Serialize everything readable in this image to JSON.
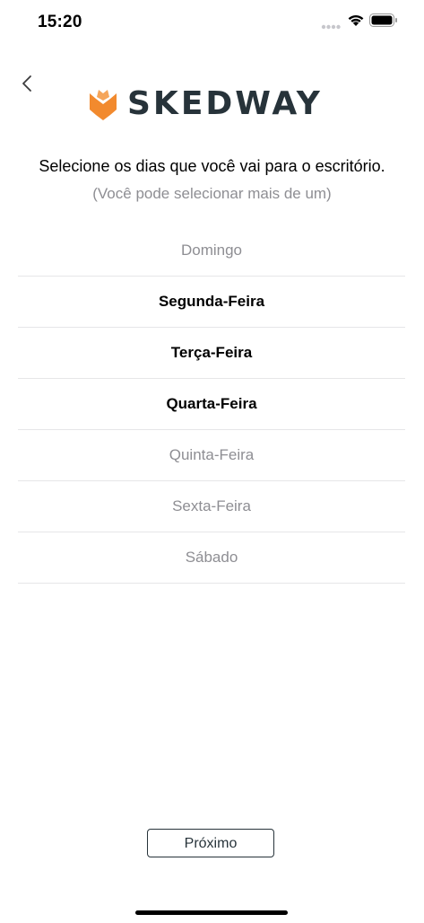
{
  "status_bar": {
    "time": "15:20"
  },
  "icons": {
    "signal": "signal-dots-icon",
    "wifi": "wifi-icon",
    "battery": "battery-icon",
    "back": "chevron-left-icon",
    "logo": "fox-logo-icon"
  },
  "brand": {
    "name": "SKEDWAY",
    "mark_color": "#f28a2e",
    "text_color": "#27333a"
  },
  "header": {
    "title": "Selecione os dias que você vai para o escritório.",
    "subtitle": "(Você pode selecionar mais de um)"
  },
  "days": [
    {
      "label": "Domingo",
      "selected": false
    },
    {
      "label": "Segunda-Feira",
      "selected": true
    },
    {
      "label": "Terça-Feira",
      "selected": true
    },
    {
      "label": "Quarta-Feira",
      "selected": true
    },
    {
      "label": "Quinta-Feira",
      "selected": false
    },
    {
      "label": "Sexta-Feira",
      "selected": false
    },
    {
      "label": "Sábado",
      "selected": false
    }
  ],
  "footer": {
    "next_label": "Próximo"
  }
}
